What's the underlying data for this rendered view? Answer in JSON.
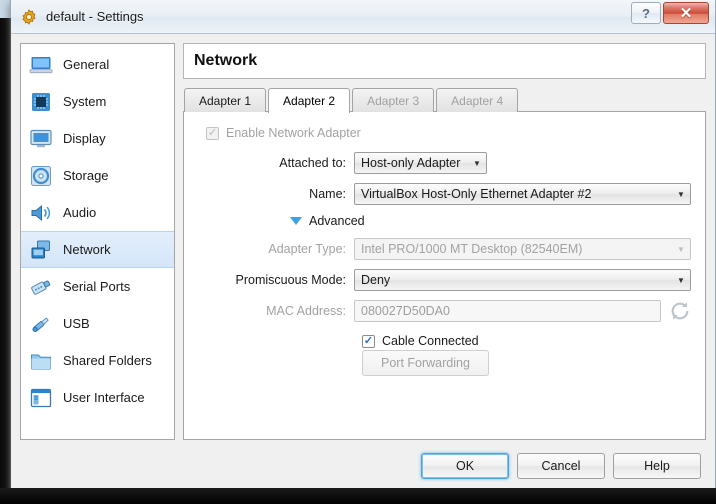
{
  "window": {
    "title": "default - Settings",
    "title_icon": "gear-icon",
    "help_button": "?",
    "close_button": "✕"
  },
  "sidebar": {
    "items": [
      {
        "label": "General",
        "icon": "monitor-icon",
        "selected": false
      },
      {
        "label": "System",
        "icon": "chip-icon",
        "selected": false
      },
      {
        "label": "Display",
        "icon": "display-icon",
        "selected": false
      },
      {
        "label": "Storage",
        "icon": "disc-icon",
        "selected": false
      },
      {
        "label": "Audio",
        "icon": "speaker-icon",
        "selected": false
      },
      {
        "label": "Network",
        "icon": "network-icon",
        "selected": true
      },
      {
        "label": "Serial Ports",
        "icon": "serial-port-icon",
        "selected": false
      },
      {
        "label": "USB",
        "icon": "usb-icon",
        "selected": false
      },
      {
        "label": "Shared Folders",
        "icon": "folder-icon",
        "selected": false
      },
      {
        "label": "User Interface",
        "icon": "user-interface-icon",
        "selected": false
      }
    ]
  },
  "main": {
    "page_title": "Network",
    "tabs": [
      {
        "label": "Adapter 1",
        "active": false,
        "disabled": false
      },
      {
        "label": "Adapter 2",
        "active": true,
        "disabled": false
      },
      {
        "label": "Adapter 3",
        "active": false,
        "disabled": true
      },
      {
        "label": "Adapter 4",
        "active": false,
        "disabled": true
      }
    ],
    "enable_adapter": {
      "label": "Enable Network Adapter",
      "checked": true,
      "disabled": true
    },
    "attached_to": {
      "label": "Attached to:",
      "value": "Host-only Adapter",
      "disabled": false
    },
    "name": {
      "label": "Name:",
      "value": "VirtualBox Host-Only Ethernet Adapter #2",
      "disabled": false
    },
    "advanced": {
      "label": "Advanced",
      "expanded": true,
      "icon": "triangle-down-icon"
    },
    "adapter_type": {
      "label": "Adapter Type:",
      "value": "Intel PRO/1000 MT Desktop (82540EM)",
      "disabled": true
    },
    "promiscuous_mode": {
      "label": "Promiscuous Mode:",
      "value": "Deny",
      "disabled": false
    },
    "mac_address": {
      "label": "MAC Address:",
      "value": "080027D50DA0",
      "disabled": true,
      "refresh_icon": "refresh-icon"
    },
    "cable_connected": {
      "label": "Cable Connected",
      "checked": true,
      "disabled": false
    },
    "port_forwarding": {
      "label": "Port Forwarding",
      "disabled": true
    }
  },
  "footer": {
    "ok": "OK",
    "cancel": "Cancel",
    "help": "Help"
  },
  "colors": {
    "accent": "#3f9fe0",
    "selection": "#d4e6f9",
    "close": "#c94b38",
    "disabled_text": "#a2a2a2"
  }
}
